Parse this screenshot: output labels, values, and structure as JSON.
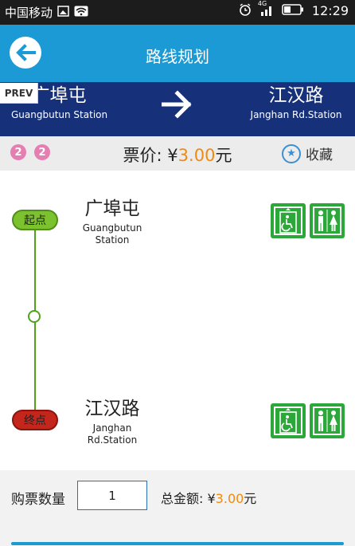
{
  "status_bar": {
    "carrier": "中国移动",
    "network": "4G",
    "time": "12:29"
  },
  "header": {
    "title": "路线规划"
  },
  "prev_label": "PREV",
  "route": {
    "from": {
      "zh": "广埠屯",
      "en": "Guangbutun Station"
    },
    "to": {
      "zh": "江汉路",
      "en": "Janghan Rd.Station"
    }
  },
  "lines": [
    "2",
    "2"
  ],
  "fare": {
    "label": "票价: ¥",
    "amount": "3.00",
    "unit": "元"
  },
  "favorite": {
    "label": "收藏"
  },
  "journey": {
    "start_tag": "起点",
    "end_tag": "终点",
    "start_station": {
      "zh": "广埠屯",
      "en1": "Guangbutun",
      "en2": "Station"
    },
    "end_station": {
      "zh": "江汉路",
      "en1": "Janghan",
      "en2": "Rd.Station"
    }
  },
  "purchase": {
    "qty_label": "购票数量",
    "qty_value": "1",
    "total_label": "总金额: ¥",
    "total_amount": "3.00",
    "total_unit": "元"
  },
  "colors": {
    "accent": "#1b9ad6",
    "route_bar": "#16307a",
    "line2": "#e67fb1",
    "price": "#f08a10",
    "start": "#7cc22e",
    "end": "#c4261c",
    "facility": "#2ca83a"
  },
  "icons": {
    "back": "arrow-left-icon",
    "direction": "arrow-right-icon",
    "favorite": "star-icon",
    "elevator": "accessible-elevator-icon",
    "restroom": "restroom-icon"
  }
}
